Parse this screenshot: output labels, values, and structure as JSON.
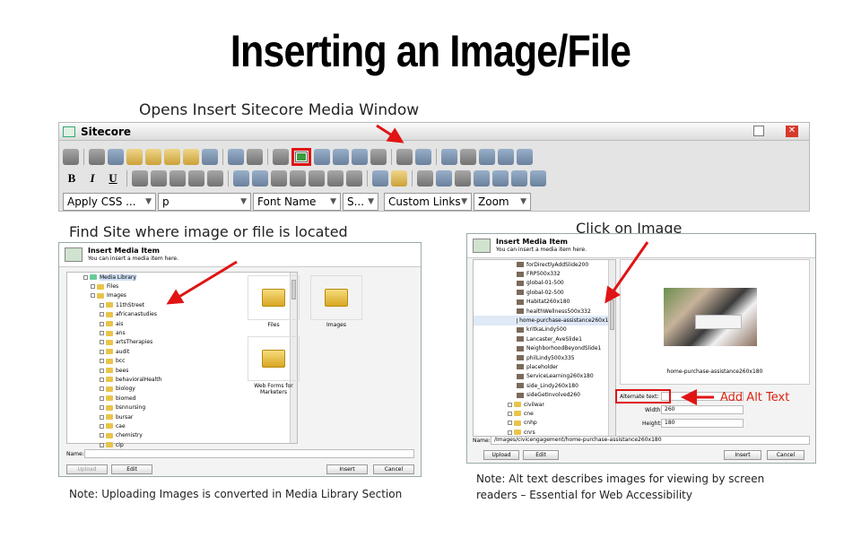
{
  "slide": {
    "title": "Inserting an Image/File",
    "callout_top": "Opens Insert Sitecore Media Window",
    "callout_left": "Find Site where image or file is located",
    "callout_right": "Click on Image",
    "add_alt_text": "Add Alt Text",
    "note_left": "Note: Uploading Images is converted in Media Library Section",
    "note_right_1": "Note:  Alt text describes images for viewing by screen",
    "note_right_2": "readers – Essential for Web Accessibility"
  },
  "editor": {
    "window_title": "Sitecore",
    "combos": {
      "css": "Apply CSS ...",
      "paragraph": "p",
      "font_name": "Font Name",
      "font_size": "S...",
      "links": "Custom Links",
      "zoom": "Zoom"
    },
    "format_buttons": [
      "B",
      "I",
      "U"
    ],
    "toolbar_icons": [
      "print-icon",
      "cut-icon",
      "copy-icon",
      "paste-icon",
      "paste-word-icon",
      "paste-text-icon",
      "paste-html-icon",
      "format-stripper-icon",
      "undo-icon",
      "redo-icon",
      "link-icon",
      "insert-image-icon",
      "insert-link-icon",
      "insert-media-icon",
      "table-icon",
      "template-icon",
      "paragraph-icon",
      "snippet-icon",
      "symbol-icon",
      "date-icon",
      "flash-icon",
      "preview-icon",
      "help-icon"
    ]
  },
  "dialog_left": {
    "title": "Insert Media Item",
    "subtitle": "You can insert a media item here.",
    "tree": [
      "Media Library",
      "Files",
      "Images",
      "11thStreet",
      "africanastudies",
      "ais",
      "ans",
      "artsTherapies",
      "audit",
      "bcc",
      "bees",
      "behavioralHealth",
      "biology",
      "biomed",
      "bsnnursing",
      "bursar",
      "cae",
      "chemistry",
      "cip"
    ],
    "tiles": [
      "Files",
      "Images",
      "Web Forms for Marketers"
    ],
    "name_label": "Name:",
    "name_value": "",
    "buttons": {
      "upload": "Upload",
      "edit": "Edit",
      "insert": "Insert",
      "cancel": "Cancel"
    }
  },
  "dialog_right": {
    "title": "Insert Media Item",
    "subtitle": "You can insert a media item here.",
    "tree": [
      "forDirectlyAddSlide200",
      "FRP500x332",
      "global-01-500",
      "global-02-500",
      "Habitat260x180",
      "healthWellness500x332",
      "home-purchase-assistance260x180",
      "kritkaLindy500",
      "Lancaster_AveSlide1",
      "NeighborhoodBeyondSlide1",
      "philLindy500x335",
      "placeholder",
      "ServiceLearning260x180",
      "side_Lindy260x180",
      "sideGetInvolved260",
      "civilwar",
      "cne",
      "cnhp",
      "cnrs"
    ],
    "selected_caption": "home-purchase-assistance260x180",
    "alt_label": "Alternate text:",
    "width_label": "Width:",
    "width_value": "260",
    "height_label": "Height:",
    "height_value": "180",
    "name_label": "Name:",
    "name_value": "/Images/civicengagement/home-purchase-assistance260x180",
    "buttons": {
      "upload": "Upload",
      "edit": "Edit",
      "insert": "Insert",
      "cancel": "Cancel"
    }
  },
  "colors": {
    "arrow": "#e01414",
    "folder": "#e9c44a"
  }
}
